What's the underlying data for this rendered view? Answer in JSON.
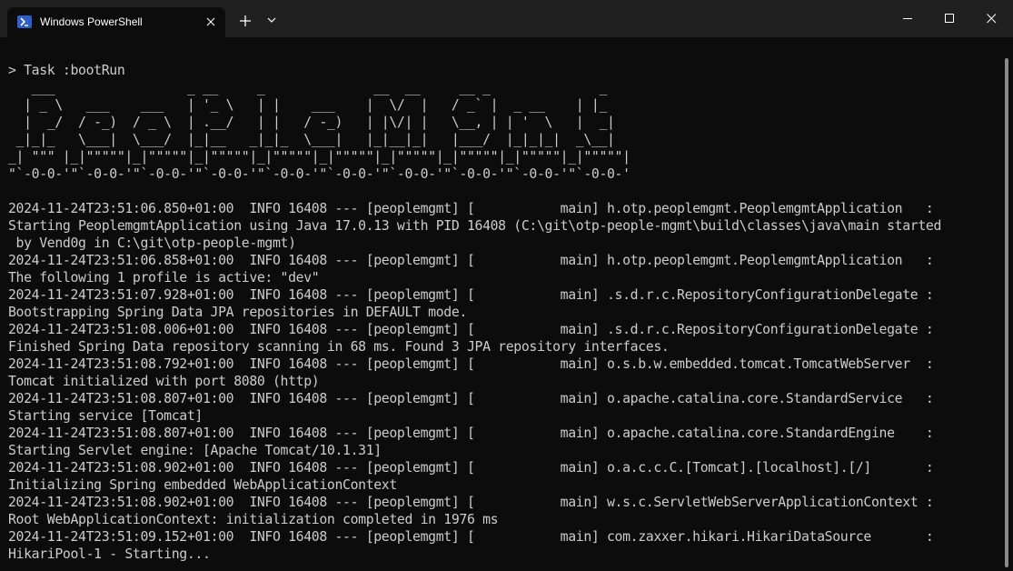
{
  "titlebar": {
    "tab_title": "Windows PowerShell",
    "icons": {
      "tab": "powershell-icon",
      "close": "close-icon",
      "new_tab": "plus-icon",
      "dropdown": "chevron-down-icon",
      "minimize": "minimize-icon",
      "maximize": "maximize-icon",
      "window_close": "close-icon"
    }
  },
  "colors": {
    "terminal_bg": "#0c0c0c",
    "terminal_fg": "#cccccc",
    "titlebar_bg": "#202020",
    "accent": "#2f5ec8"
  },
  "terminal": {
    "lines": [
      "> Task :bootRun",
      "   ___                 _ __     _              __  __     __ _              _",
      "  | _ \\   ___    ___   | '_ \\   | |    ___    |  \\/  |   / _` |  _ __    | |_",
      "  |  _/  / -_)  / _ \\  | .__/   | |   / -_)   | |\\/| |   \\__, | | '  \\   |  _|",
      " _|_|_   \\___|  \\___/  |_|__   _|_|_  \\___|   |_|__|_|   |___/  |_|_|_|  _\\__|",
      "_| \"\"\" |_|\"\"\"\"\"|_|\"\"\"\"\"|_|\"\"\"\"\"|_|\"\"\"\"\"|_|\"\"\"\"\"|_|\"\"\"\"\"|_|\"\"\"\"\"|_|\"\"\"\"\"|_|\"\"\"\"\"|",
      "\"`-0-0-'\"`-0-0-'\"`-0-0-'\"`-0-0-'\"`-0-0-'\"`-0-0-'\"`-0-0-'\"`-0-0-'\"`-0-0-'\"`-0-0-'",
      "",
      "2024-11-24T23:51:06.850+01:00  INFO 16408 --- [peoplemgmt] [           main] h.otp.peoplemgmt.PeoplemgmtApplication   :",
      "Starting PeoplemgmtApplication using Java 17.0.13 with PID 16408 (C:\\git\\otp-people-mgmt\\build\\classes\\java\\main started",
      " by Vend0g in C:\\git\\otp-people-mgmt)",
      "2024-11-24T23:51:06.858+01:00  INFO 16408 --- [peoplemgmt] [           main] h.otp.peoplemgmt.PeoplemgmtApplication   :",
      "The following 1 profile is active: \"dev\"",
      "2024-11-24T23:51:07.928+01:00  INFO 16408 --- [peoplemgmt] [           main] .s.d.r.c.RepositoryConfigurationDelegate :",
      "Bootstrapping Spring Data JPA repositories in DEFAULT mode.",
      "2024-11-24T23:51:08.006+01:00  INFO 16408 --- [peoplemgmt] [           main] .s.d.r.c.RepositoryConfigurationDelegate :",
      "Finished Spring Data repository scanning in 68 ms. Found 3 JPA repository interfaces.",
      "2024-11-24T23:51:08.792+01:00  INFO 16408 --- [peoplemgmt] [           main] o.s.b.w.embedded.tomcat.TomcatWebServer  :",
      "Tomcat initialized with port 8080 (http)",
      "2024-11-24T23:51:08.807+01:00  INFO 16408 --- [peoplemgmt] [           main] o.apache.catalina.core.StandardService   :",
      "Starting service [Tomcat]",
      "2024-11-24T23:51:08.807+01:00  INFO 16408 --- [peoplemgmt] [           main] o.apache.catalina.core.StandardEngine    :",
      "Starting Servlet engine: [Apache Tomcat/10.1.31]",
      "2024-11-24T23:51:08.902+01:00  INFO 16408 --- [peoplemgmt] [           main] o.a.c.c.C.[Tomcat].[localhost].[/]       :",
      "Initializing Spring embedded WebApplicationContext",
      "2024-11-24T23:51:08.902+01:00  INFO 16408 --- [peoplemgmt] [           main] w.s.c.ServletWebServerApplicationContext :",
      "Root WebApplicationContext: initialization completed in 1976 ms",
      "2024-11-24T23:51:09.152+01:00  INFO 16408 --- [peoplemgmt] [           main] com.zaxxer.hikari.HikariDataSource       :",
      "HikariPool-1 - Starting..."
    ]
  }
}
